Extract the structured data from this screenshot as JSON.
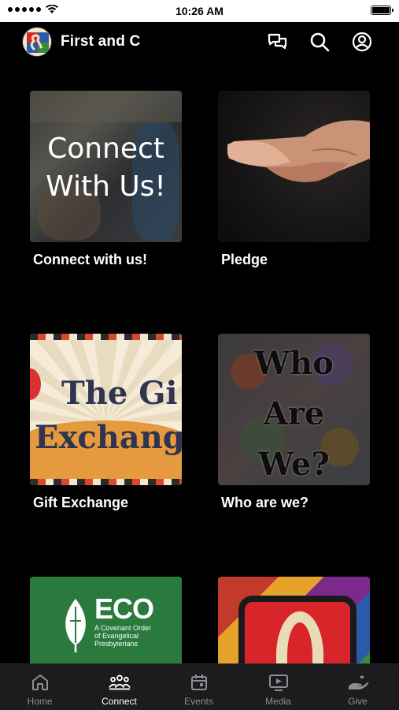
{
  "status_bar": {
    "time": "10:26 AM"
  },
  "header": {
    "title": "First and C",
    "icons": [
      "chat-icon",
      "search-icon",
      "profile-icon"
    ]
  },
  "cards": [
    {
      "label": "Connect with us!",
      "thumb_text": [
        "Connect",
        "With Us!"
      ]
    },
    {
      "label": "Pledge"
    },
    {
      "label": "Gift Exchange",
      "thumb_text": [
        "The Gi",
        "Exchang"
      ]
    },
    {
      "label": "Who are we?",
      "thumb_text": [
        "Who",
        "Are",
        "We?"
      ]
    },
    {
      "label": "",
      "thumb_text": [
        "ECO",
        "A Covenant Order",
        "of Evangelical",
        "Presbyterians"
      ]
    },
    {
      "label": ""
    }
  ],
  "tabs": [
    {
      "label": "Home",
      "icon": "home-icon",
      "active": false
    },
    {
      "label": "Connect",
      "icon": "people-icon",
      "active": true
    },
    {
      "label": "Events",
      "icon": "calendar-icon",
      "active": false
    },
    {
      "label": "Media",
      "icon": "media-icon",
      "active": false
    },
    {
      "label": "Give",
      "icon": "give-icon",
      "active": false
    }
  ],
  "colors": {
    "background": "#000000",
    "tabbar": "#1c1c1e",
    "tab_inactive": "#8e8e93",
    "tab_active": "#ffffff"
  }
}
